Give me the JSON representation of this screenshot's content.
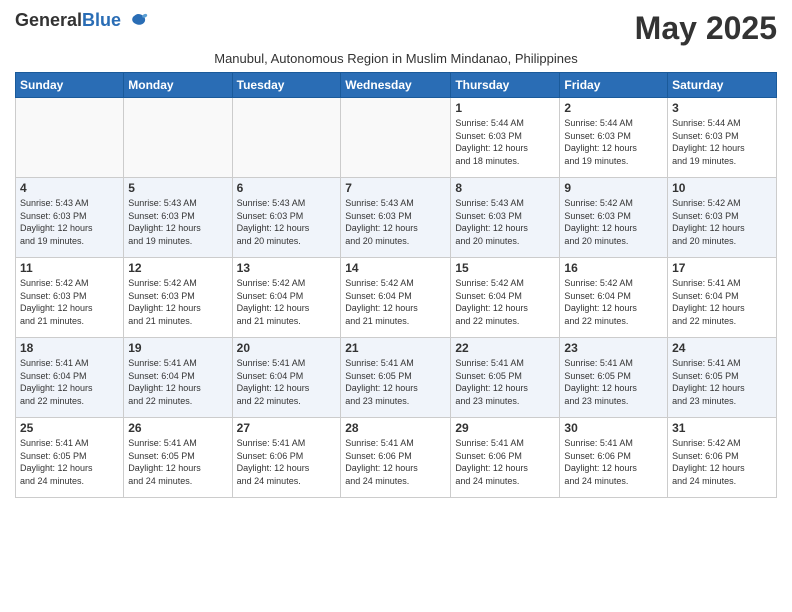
{
  "header": {
    "logo_general": "General",
    "logo_blue": "Blue",
    "month_title": "May 2025",
    "subtitle": "Manubul, Autonomous Region in Muslim Mindanao, Philippines"
  },
  "weekdays": [
    "Sunday",
    "Monday",
    "Tuesday",
    "Wednesday",
    "Thursday",
    "Friday",
    "Saturday"
  ],
  "weeks": [
    [
      {
        "day": "",
        "info": ""
      },
      {
        "day": "",
        "info": ""
      },
      {
        "day": "",
        "info": ""
      },
      {
        "day": "",
        "info": ""
      },
      {
        "day": "1",
        "info": "Sunrise: 5:44 AM\nSunset: 6:03 PM\nDaylight: 12 hours\nand 18 minutes."
      },
      {
        "day": "2",
        "info": "Sunrise: 5:44 AM\nSunset: 6:03 PM\nDaylight: 12 hours\nand 19 minutes."
      },
      {
        "day": "3",
        "info": "Sunrise: 5:44 AM\nSunset: 6:03 PM\nDaylight: 12 hours\nand 19 minutes."
      }
    ],
    [
      {
        "day": "4",
        "info": "Sunrise: 5:43 AM\nSunset: 6:03 PM\nDaylight: 12 hours\nand 19 minutes."
      },
      {
        "day": "5",
        "info": "Sunrise: 5:43 AM\nSunset: 6:03 PM\nDaylight: 12 hours\nand 19 minutes."
      },
      {
        "day": "6",
        "info": "Sunrise: 5:43 AM\nSunset: 6:03 PM\nDaylight: 12 hours\nand 20 minutes."
      },
      {
        "day": "7",
        "info": "Sunrise: 5:43 AM\nSunset: 6:03 PM\nDaylight: 12 hours\nand 20 minutes."
      },
      {
        "day": "8",
        "info": "Sunrise: 5:43 AM\nSunset: 6:03 PM\nDaylight: 12 hours\nand 20 minutes."
      },
      {
        "day": "9",
        "info": "Sunrise: 5:42 AM\nSunset: 6:03 PM\nDaylight: 12 hours\nand 20 minutes."
      },
      {
        "day": "10",
        "info": "Sunrise: 5:42 AM\nSunset: 6:03 PM\nDaylight: 12 hours\nand 20 minutes."
      }
    ],
    [
      {
        "day": "11",
        "info": "Sunrise: 5:42 AM\nSunset: 6:03 PM\nDaylight: 12 hours\nand 21 minutes."
      },
      {
        "day": "12",
        "info": "Sunrise: 5:42 AM\nSunset: 6:03 PM\nDaylight: 12 hours\nand 21 minutes."
      },
      {
        "day": "13",
        "info": "Sunrise: 5:42 AM\nSunset: 6:04 PM\nDaylight: 12 hours\nand 21 minutes."
      },
      {
        "day": "14",
        "info": "Sunrise: 5:42 AM\nSunset: 6:04 PM\nDaylight: 12 hours\nand 21 minutes."
      },
      {
        "day": "15",
        "info": "Sunrise: 5:42 AM\nSunset: 6:04 PM\nDaylight: 12 hours\nand 22 minutes."
      },
      {
        "day": "16",
        "info": "Sunrise: 5:42 AM\nSunset: 6:04 PM\nDaylight: 12 hours\nand 22 minutes."
      },
      {
        "day": "17",
        "info": "Sunrise: 5:41 AM\nSunset: 6:04 PM\nDaylight: 12 hours\nand 22 minutes."
      }
    ],
    [
      {
        "day": "18",
        "info": "Sunrise: 5:41 AM\nSunset: 6:04 PM\nDaylight: 12 hours\nand 22 minutes."
      },
      {
        "day": "19",
        "info": "Sunrise: 5:41 AM\nSunset: 6:04 PM\nDaylight: 12 hours\nand 22 minutes."
      },
      {
        "day": "20",
        "info": "Sunrise: 5:41 AM\nSunset: 6:04 PM\nDaylight: 12 hours\nand 22 minutes."
      },
      {
        "day": "21",
        "info": "Sunrise: 5:41 AM\nSunset: 6:05 PM\nDaylight: 12 hours\nand 23 minutes."
      },
      {
        "day": "22",
        "info": "Sunrise: 5:41 AM\nSunset: 6:05 PM\nDaylight: 12 hours\nand 23 minutes."
      },
      {
        "day": "23",
        "info": "Sunrise: 5:41 AM\nSunset: 6:05 PM\nDaylight: 12 hours\nand 23 minutes."
      },
      {
        "day": "24",
        "info": "Sunrise: 5:41 AM\nSunset: 6:05 PM\nDaylight: 12 hours\nand 23 minutes."
      }
    ],
    [
      {
        "day": "25",
        "info": "Sunrise: 5:41 AM\nSunset: 6:05 PM\nDaylight: 12 hours\nand 24 minutes."
      },
      {
        "day": "26",
        "info": "Sunrise: 5:41 AM\nSunset: 6:05 PM\nDaylight: 12 hours\nand 24 minutes."
      },
      {
        "day": "27",
        "info": "Sunrise: 5:41 AM\nSunset: 6:06 PM\nDaylight: 12 hours\nand 24 minutes."
      },
      {
        "day": "28",
        "info": "Sunrise: 5:41 AM\nSunset: 6:06 PM\nDaylight: 12 hours\nand 24 minutes."
      },
      {
        "day": "29",
        "info": "Sunrise: 5:41 AM\nSunset: 6:06 PM\nDaylight: 12 hours\nand 24 minutes."
      },
      {
        "day": "30",
        "info": "Sunrise: 5:41 AM\nSunset: 6:06 PM\nDaylight: 12 hours\nand 24 minutes."
      },
      {
        "day": "31",
        "info": "Sunrise: 5:42 AM\nSunset: 6:06 PM\nDaylight: 12 hours\nand 24 minutes."
      }
    ]
  ]
}
